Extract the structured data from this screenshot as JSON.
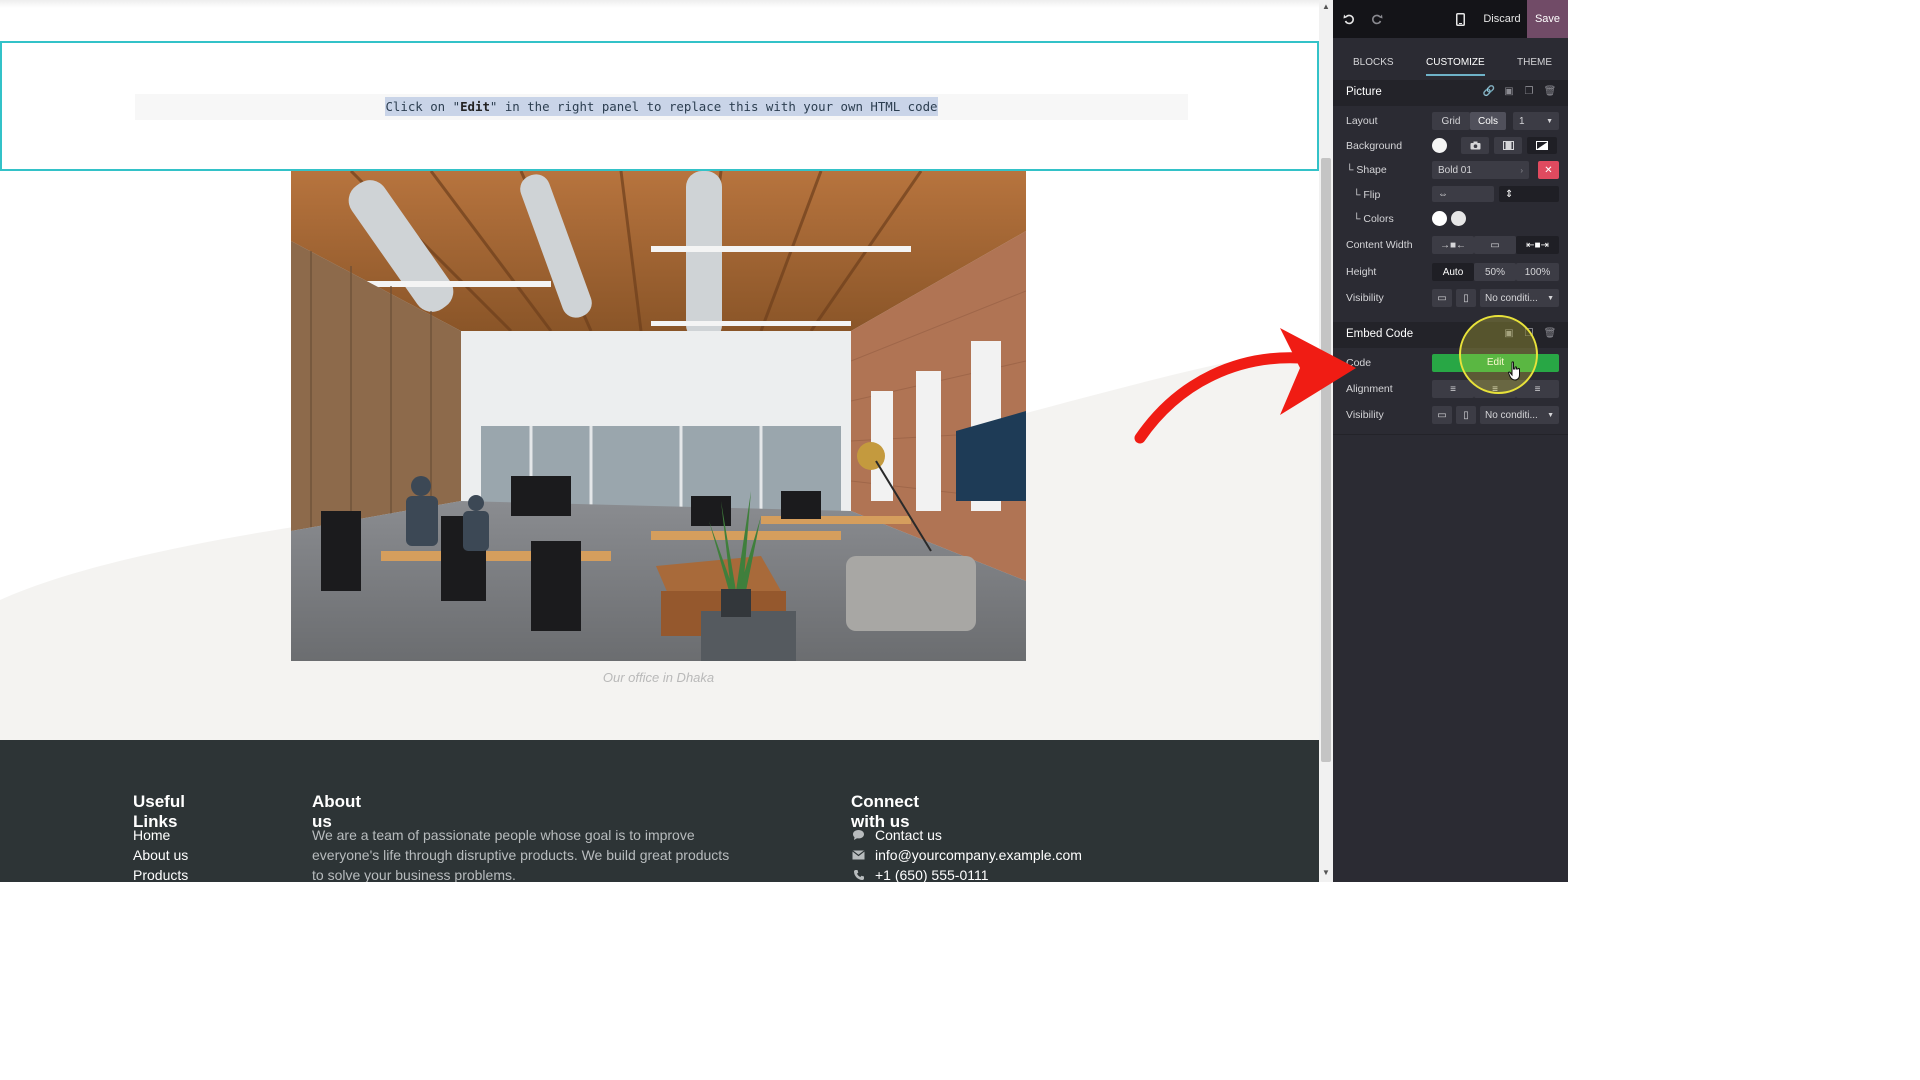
{
  "embed": {
    "code_prefix": "Click on \"",
    "code_bold": "Edit",
    "code_suffix": "\" in the right panel to replace this with your own HTML code"
  },
  "picture": {
    "caption": "Our office in Dhaka"
  },
  "footer": {
    "useful_links": {
      "title": "Useful Links",
      "items": [
        "Home",
        "About us",
        "Products"
      ]
    },
    "about": {
      "title": "About us",
      "text": "We are a team of passionate people whose goal is to improve everyone's life through disruptive products. We build great products to solve your business problems."
    },
    "connect": {
      "title": "Connect with us",
      "contact": "Contact us",
      "email": "info@yourcompany.example.com",
      "phone": "+1 (650) 555-0111"
    }
  },
  "editor": {
    "topbar": {
      "undo_icon": "undo-icon",
      "redo_icon": "redo-icon",
      "mobile_icon": "mobile-preview-icon",
      "discard": "Discard",
      "save": "Save"
    },
    "tabs": [
      "BLOCKS",
      "CUSTOMIZE",
      "THEME"
    ],
    "active_tab": "CUSTOMIZE",
    "picture_section": {
      "title": "Picture",
      "layout": {
        "label": "Layout",
        "options": [
          "Grid",
          "Cols"
        ],
        "selected": "Cols",
        "cols_value": "1"
      },
      "background": {
        "label": "Background"
      },
      "shape": {
        "label": "Shape",
        "value": "Bold 01"
      },
      "flip": {
        "label": "Flip"
      },
      "colors": {
        "label": "Colors"
      },
      "content_width": {
        "label": "Content Width"
      },
      "height": {
        "label": "Height",
        "options": [
          "Auto",
          "50%",
          "100%"
        ],
        "selected": "Auto"
      },
      "visibility": {
        "label": "Visibility",
        "value": "No conditi..."
      }
    },
    "embed_section": {
      "title": "Embed Code",
      "code": {
        "label": "Code",
        "button": "Edit"
      },
      "alignment": {
        "label": "Alignment"
      },
      "visibility": {
        "label": "Visibility",
        "value": "No conditi..."
      }
    }
  },
  "colors": {
    "panel_bg": "#2b2b33",
    "save_bg": "#714b67",
    "edit_green": "#28a745",
    "embed_outline": "#33c2c8",
    "footer_bg": "#2d3436",
    "annotation_arrow": "#f01c14"
  }
}
